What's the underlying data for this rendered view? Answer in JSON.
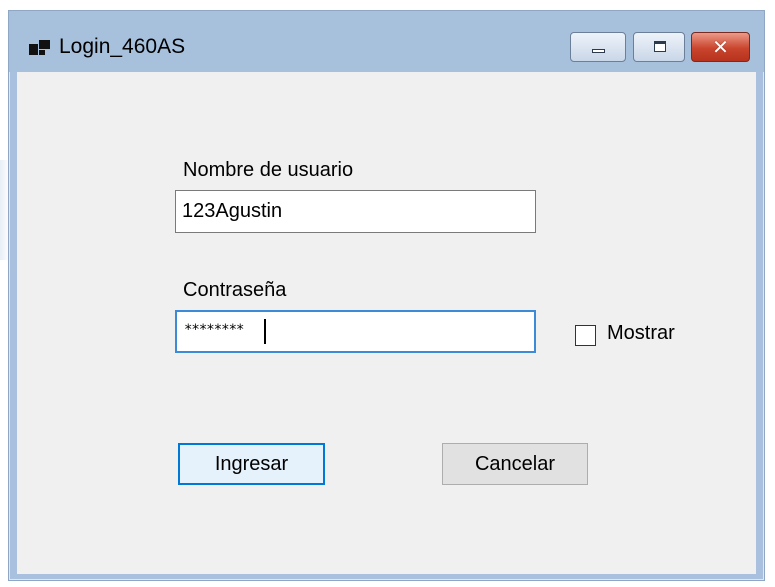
{
  "window": {
    "title": "Login_460AS"
  },
  "form": {
    "username_label": "Nombre de usuario",
    "username_value": "123Agustin",
    "password_label": "Contraseña",
    "password_value": "********",
    "show_label": "Mostrar",
    "show_checked": false,
    "submit_label": "Ingresar",
    "cancel_label": "Cancelar"
  },
  "icons": {
    "app": "app-window-icon",
    "minimize": "minimize-icon",
    "maximize": "maximize-icon",
    "close": "close-icon"
  },
  "colors": {
    "focus_border": "#0078d7",
    "titlebar": "#a7c0dc",
    "close_button": "#c9452e",
    "client_background": "#f0f0f0"
  }
}
